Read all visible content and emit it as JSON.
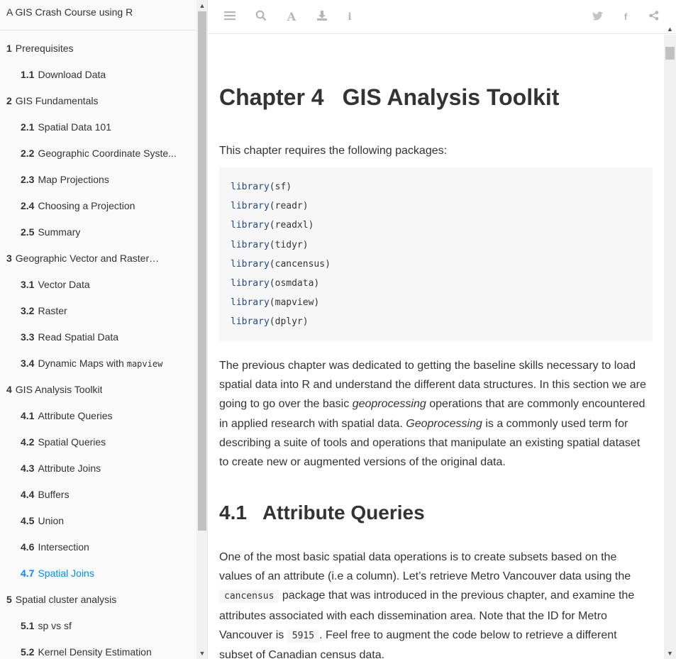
{
  "book_title": "A GIS Crash Course using R",
  "toc": [
    {
      "num": "1",
      "label": "Prerequisites",
      "level": 1
    },
    {
      "num": "1.1",
      "label": "Download Data",
      "level": 2
    },
    {
      "num": "2",
      "label": "GIS Fundamentals",
      "level": 1
    },
    {
      "num": "2.1",
      "label": "Spatial Data 101",
      "level": 2
    },
    {
      "num": "2.2",
      "label": "Geographic Coordinate Syste...",
      "level": 2
    },
    {
      "num": "2.3",
      "label": "Map Projections",
      "level": 2
    },
    {
      "num": "2.4",
      "label": "Choosing a Projection",
      "level": 2
    },
    {
      "num": "2.5",
      "label": "Summary",
      "level": 2
    },
    {
      "num": "3",
      "label": "Geographic Vector and Raster Dat...",
      "level": 1
    },
    {
      "num": "3.1",
      "label": "Vector Data",
      "level": 2
    },
    {
      "num": "3.2",
      "label": "Raster",
      "level": 2
    },
    {
      "num": "3.3",
      "label": "Read Spatial Data",
      "level": 2
    },
    {
      "num": "3.4",
      "label": "Dynamic Maps with",
      "code": "mapview",
      "level": 2
    },
    {
      "num": "4",
      "label": "GIS Analysis Toolkit",
      "level": 1
    },
    {
      "num": "4.1",
      "label": "Attribute Queries",
      "level": 2
    },
    {
      "num": "4.2",
      "label": "Spatial Queries",
      "level": 2
    },
    {
      "num": "4.3",
      "label": "Attribute Joins",
      "level": 2
    },
    {
      "num": "4.4",
      "label": "Buffers",
      "level": 2
    },
    {
      "num": "4.5",
      "label": "Union",
      "level": 2
    },
    {
      "num": "4.6",
      "label": "Intersection",
      "level": 2
    },
    {
      "num": "4.7",
      "label": "Spatial Joins",
      "level": 2,
      "active": true
    },
    {
      "num": "5",
      "label": "Spatial cluster analysis",
      "level": 1
    },
    {
      "num": "5.1",
      "label": "sp vs sf",
      "level": 2
    },
    {
      "num": "5.2",
      "label": "Kernel Density Estimation",
      "level": 2
    }
  ],
  "toolbar": {
    "left_icons": [
      "menu-icon",
      "search-icon",
      "font-icon",
      "download-icon",
      "info-icon"
    ],
    "right_icons": [
      "twitter-icon",
      "facebook-icon",
      "share-icon"
    ]
  },
  "chapter": {
    "num": "Chapter 4",
    "title": "GIS Analysis Toolkit"
  },
  "intro": "This chapter requires the following packages:",
  "code_lines": [
    {
      "fn": "library",
      "arg": "(sf)"
    },
    {
      "fn": "library",
      "arg": "(readr)"
    },
    {
      "fn": "library",
      "arg": "(readxl)"
    },
    {
      "fn": "library",
      "arg": "(tidyr)"
    },
    {
      "fn": "library",
      "arg": "(cancensus)"
    },
    {
      "fn": "library",
      "arg": "(osmdata)"
    },
    {
      "fn": "library",
      "arg": "(mapview)"
    },
    {
      "fn": "library",
      "arg": "(dplyr)"
    }
  ],
  "para2": {
    "a": "The previous chapter was dedicated to getting the baseline skills necessary to load spatial data into R and understand the different data structures. In this section we are going to go over the basic ",
    "em1": "geoprocessing",
    "b": " operations that are commonly encountered in applied research with spatial data. ",
    "em2": "Geoprocessing",
    "c": " is a commonly used term for describing a suite of tools and operations that manipulate an existing spatial dataset to create new or augmented versions of the original data."
  },
  "section": {
    "num": "4.1",
    "title": "Attribute Queries"
  },
  "para3": {
    "a": "One of the most basic spatial data operations is to create subsets based on the values of an attribute (i.e a column). Let’s retrieve Metro Vancouver data using the ",
    "code1": "cancensus",
    "b": " package that was introduced in the previous chapter, and examine the attributes associated with each dissemination area. Note that the ID for Metro Vancouver is ",
    "code2": "5915",
    "c": ". Feel free to augment the code below to retrieve a different subset of Canadian census data."
  }
}
